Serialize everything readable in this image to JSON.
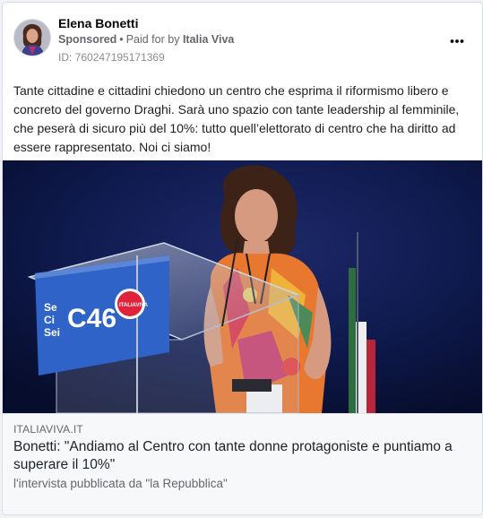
{
  "post": {
    "page_name": "Elena Bonetti",
    "sponsored_label": "Sponsored",
    "separator": "•",
    "paid_for_prefix": "Paid for by",
    "paid_for_by": "Italia Viva",
    "ad_id": "ID: 760247195171369",
    "menu_icon": "more-options-icon",
    "body_text": "Tante cittadine e cittadini chiedono un centro che esprima il riformismo libero e concreto del governo Draghi. Sarà uno spazio con tante leadership al femminile, che peserà di sicuro più del 10%: tutto quell’elettorato di centro che ha diritto ad essere rappresentato. Noi ci siamo!"
  },
  "media": {
    "podium_sign_lines": [
      "Se",
      "Ci",
      "Sei"
    ],
    "podium_sign_big": "C46",
    "podium_logo": "ITALIAVIVA"
  },
  "link": {
    "domain": "ITALIAVIVA.IT",
    "headline": "Bonetti: \"Andiamo al Centro con tante donne protagoniste e puntiamo a superare il 10%\"",
    "description": "l'intervista pubblicata da \"la Repubblica\""
  },
  "colors": {
    "background": "#f0f2f5",
    "card": "#ffffff",
    "text_primary": "#050505",
    "text_secondary": "#65676b",
    "stage_blue": "#0b1440",
    "podium_blue": "#2f63c7"
  }
}
